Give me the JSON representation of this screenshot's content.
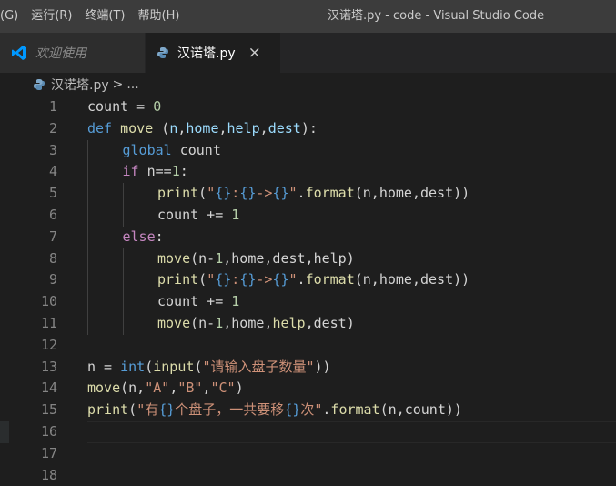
{
  "menu": [
    "(G)",
    "运行(R)",
    "终端(T)",
    "帮助(H)"
  ],
  "window_title": "汉诺塔.py - code - Visual Studio Code",
  "tabs": [
    {
      "label": "欢迎使用",
      "active": false
    },
    {
      "label": "汉诺塔.py",
      "active": true
    }
  ],
  "tab_close_glyph": "×",
  "breadcrumb": {
    "file": "汉诺塔.py",
    "separator": ">",
    "rest": "..."
  },
  "colors": {
    "keyword": "#569cd6",
    "function": "#dcdcaa",
    "string": "#ce9178",
    "number": "#b5cea8",
    "variable": "#9cdcfe",
    "control": "#c586c0",
    "text": "#d4d4d4",
    "line_number": "#858585",
    "vscode_blue": "#0098ff"
  },
  "icons": {
    "welcome_tab": "vscode-logo-icon",
    "file": "python-file-icon",
    "close": "close-icon"
  },
  "editor": {
    "current_line": 16,
    "lines": [
      {
        "n": "1",
        "tokens": [
          {
            "t": "count",
            "c": "tx"
          },
          {
            "t": " = ",
            "c": "tx"
          },
          {
            "t": "0",
            "c": "num"
          }
        ]
      },
      {
        "n": "2",
        "tokens": [
          {
            "t": "def",
            "c": "kw"
          },
          {
            "t": " ",
            "c": "tx"
          },
          {
            "t": "move",
            "c": "fn"
          },
          {
            "t": " (",
            "c": "tx"
          },
          {
            "t": "n",
            "c": "var"
          },
          {
            "t": ",",
            "c": "tx"
          },
          {
            "t": "home",
            "c": "var"
          },
          {
            "t": ",",
            "c": "tx"
          },
          {
            "t": "help",
            "c": "var"
          },
          {
            "t": ",",
            "c": "tx"
          },
          {
            "t": "dest",
            "c": "var"
          },
          {
            "t": "):",
            "c": "tx"
          }
        ]
      },
      {
        "n": "3",
        "indent": 1,
        "tokens": [
          {
            "t": "global",
            "c": "kw"
          },
          {
            "t": " count",
            "c": "tx"
          }
        ]
      },
      {
        "n": "4",
        "indent": 1,
        "tokens": [
          {
            "t": "if",
            "c": "ctl"
          },
          {
            "t": " n==",
            "c": "tx"
          },
          {
            "t": "1",
            "c": "num"
          },
          {
            "t": ":",
            "c": "tx"
          }
        ]
      },
      {
        "n": "5",
        "indent": 2,
        "tokens": [
          {
            "t": "print",
            "c": "fn"
          },
          {
            "t": "(",
            "c": "tx"
          },
          {
            "t": "\"",
            "c": "str"
          },
          {
            "t": "{}",
            "c": "kw"
          },
          {
            "t": ":",
            "c": "str"
          },
          {
            "t": "{}",
            "c": "kw"
          },
          {
            "t": "->",
            "c": "str"
          },
          {
            "t": "{}",
            "c": "kw"
          },
          {
            "t": "\"",
            "c": "str"
          },
          {
            "t": ".",
            "c": "tx"
          },
          {
            "t": "format",
            "c": "fn"
          },
          {
            "t": "(n,home,dest))",
            "c": "tx"
          }
        ]
      },
      {
        "n": "6",
        "indent": 2,
        "tokens": [
          {
            "t": "count += ",
            "c": "tx"
          },
          {
            "t": "1",
            "c": "num"
          }
        ]
      },
      {
        "n": "7",
        "indent": 1,
        "tokens": [
          {
            "t": "else",
            "c": "ctl"
          },
          {
            "t": ":",
            "c": "tx"
          }
        ]
      },
      {
        "n": "8",
        "indent": 2,
        "tokens": [
          {
            "t": "move",
            "c": "fn"
          },
          {
            "t": "(n-",
            "c": "tx"
          },
          {
            "t": "1",
            "c": "num"
          },
          {
            "t": ",home,dest,help)",
            "c": "tx"
          }
        ]
      },
      {
        "n": "9",
        "indent": 2,
        "tokens": [
          {
            "t": "print",
            "c": "fn"
          },
          {
            "t": "(",
            "c": "tx"
          },
          {
            "t": "\"",
            "c": "str"
          },
          {
            "t": "{}",
            "c": "kw"
          },
          {
            "t": ":",
            "c": "str"
          },
          {
            "t": "{}",
            "c": "kw"
          },
          {
            "t": "->",
            "c": "str"
          },
          {
            "t": "{}",
            "c": "kw"
          },
          {
            "t": "\"",
            "c": "str"
          },
          {
            "t": ".",
            "c": "tx"
          },
          {
            "t": "format",
            "c": "fn"
          },
          {
            "t": "(n,home,dest))",
            "c": "tx"
          }
        ]
      },
      {
        "n": "10",
        "indent": 2,
        "tokens": [
          {
            "t": "count += ",
            "c": "tx"
          },
          {
            "t": "1",
            "c": "num"
          }
        ]
      },
      {
        "n": "11",
        "indent": 2,
        "tokens": [
          {
            "t": "move",
            "c": "fn"
          },
          {
            "t": "(n-",
            "c": "tx"
          },
          {
            "t": "1",
            "c": "num"
          },
          {
            "t": ",home,",
            "c": "tx"
          },
          {
            "t": "help",
            "c": "fn"
          },
          {
            "t": ",dest)",
            "c": "tx"
          }
        ]
      },
      {
        "n": "12",
        "tokens": []
      },
      {
        "n": "13",
        "tokens": [
          {
            "t": "n = ",
            "c": "tx"
          },
          {
            "t": "int",
            "c": "kw"
          },
          {
            "t": "(",
            "c": "tx"
          },
          {
            "t": "input",
            "c": "fn"
          },
          {
            "t": "(",
            "c": "tx"
          },
          {
            "t": "\"请输入盘子数量\"",
            "c": "str"
          },
          {
            "t": "))",
            "c": "tx"
          }
        ]
      },
      {
        "n": "14",
        "tokens": [
          {
            "t": "move",
            "c": "fn"
          },
          {
            "t": "(n,",
            "c": "tx"
          },
          {
            "t": "\"A\"",
            "c": "str"
          },
          {
            "t": ",",
            "c": "tx"
          },
          {
            "t": "\"B\"",
            "c": "str"
          },
          {
            "t": ",",
            "c": "tx"
          },
          {
            "t": "\"C\"",
            "c": "str"
          },
          {
            "t": ")",
            "c": "tx"
          }
        ]
      },
      {
        "n": "15",
        "tokens": [
          {
            "t": "print",
            "c": "fn"
          },
          {
            "t": "(",
            "c": "tx"
          },
          {
            "t": "\"有",
            "c": "str"
          },
          {
            "t": "{}",
            "c": "kw"
          },
          {
            "t": "个盘子，一共要移",
            "c": "str"
          },
          {
            "t": "{}",
            "c": "kw"
          },
          {
            "t": "次\"",
            "c": "str"
          },
          {
            "t": ".",
            "c": "tx"
          },
          {
            "t": "format",
            "c": "fn"
          },
          {
            "t": "(n,count))",
            "c": "tx"
          }
        ]
      },
      {
        "n": "16",
        "tokens": []
      },
      {
        "n": "17",
        "tokens": []
      },
      {
        "n": "18",
        "tokens": []
      }
    ]
  }
}
